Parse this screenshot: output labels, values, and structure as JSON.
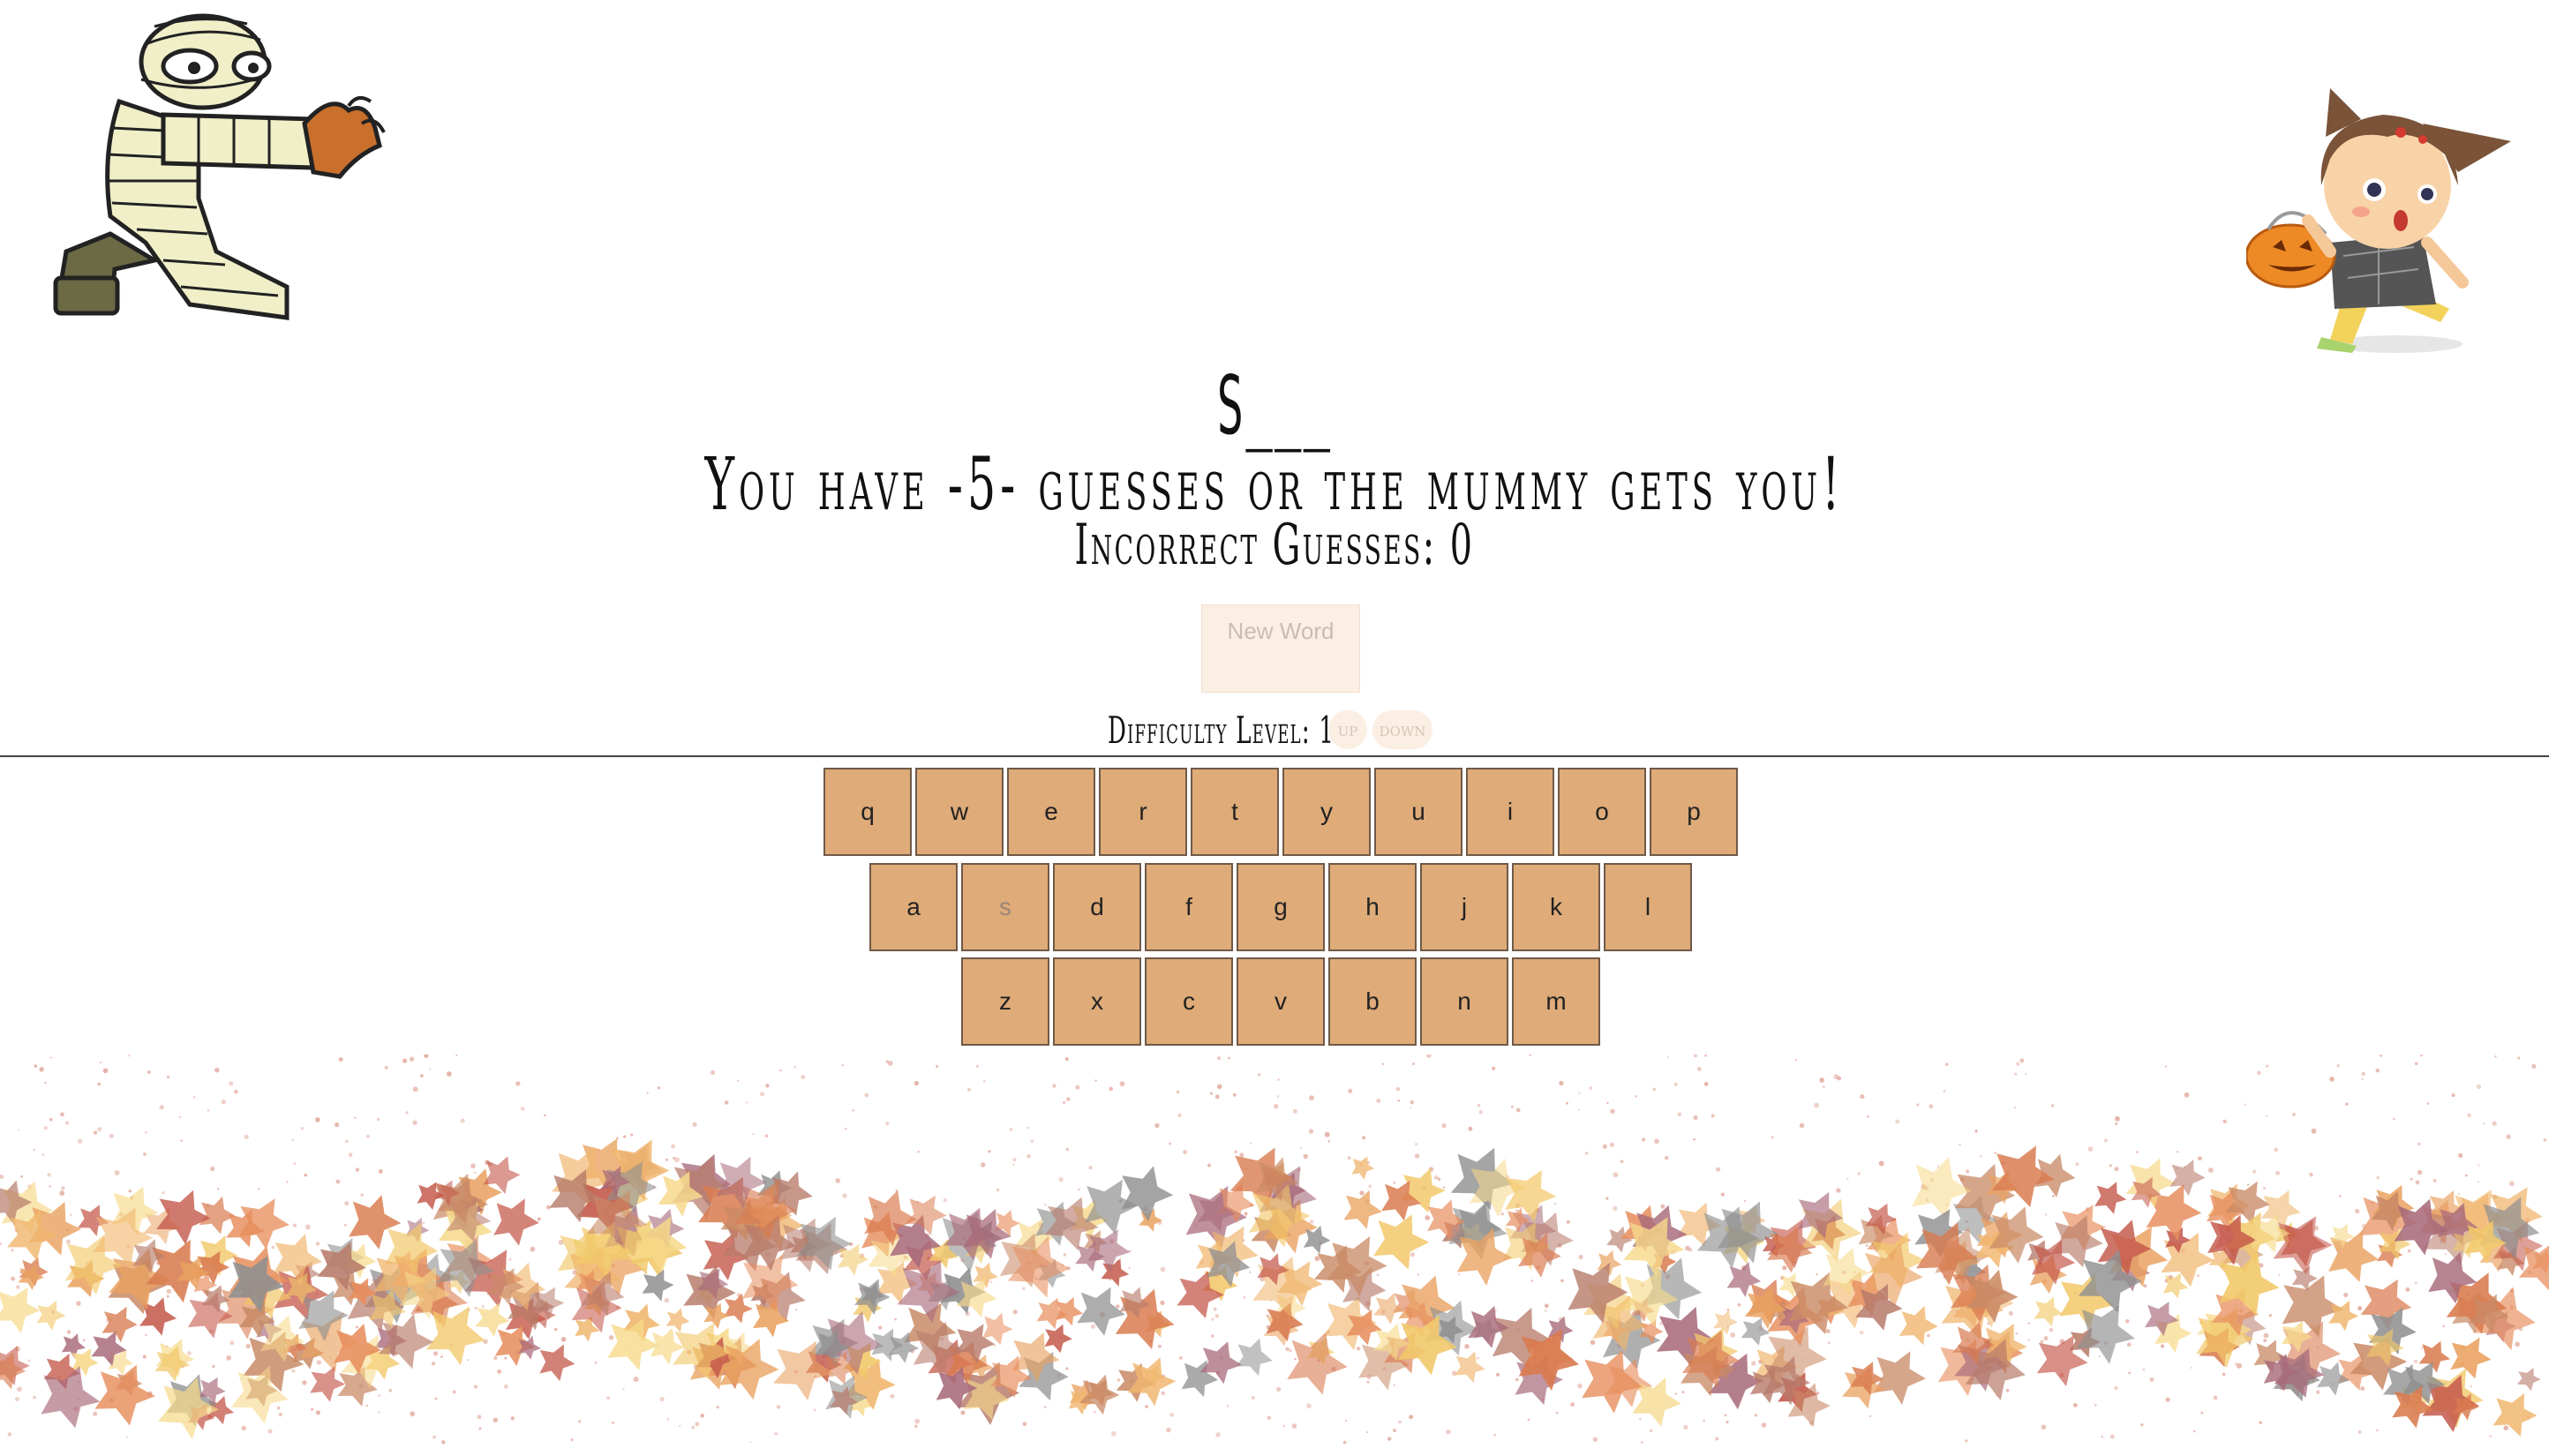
{
  "game": {
    "word_display": "S___",
    "guesses_message": "You have -5- guesses or the mummy gets you!",
    "incorrect_guesses_label": "Incorrect Guesses:",
    "incorrect_guesses_count": "0",
    "new_word_label": "New Word",
    "difficulty_label": "Difficulty Level:",
    "difficulty_value": "1",
    "difficulty_up_label": "up",
    "difficulty_down_label": "down"
  },
  "keyboard": {
    "rows": [
      [
        "q",
        "w",
        "e",
        "r",
        "t",
        "y",
        "u",
        "i",
        "o",
        "p"
      ],
      [
        "a",
        "s",
        "d",
        "f",
        "g",
        "h",
        "j",
        "k",
        "l"
      ],
      [
        "z",
        "x",
        "c",
        "v",
        "b",
        "n",
        "m"
      ]
    ],
    "used_letters": [
      "s"
    ]
  },
  "colors": {
    "key_fill": "#dfab78",
    "key_border": "#6f5a48",
    "button_fill": "#fbeee3"
  },
  "images": {
    "mummy": "mummy-character-icon",
    "kid": "trick-or-treat-kid-icon",
    "leaves": "autumn-leaves-decoration"
  }
}
